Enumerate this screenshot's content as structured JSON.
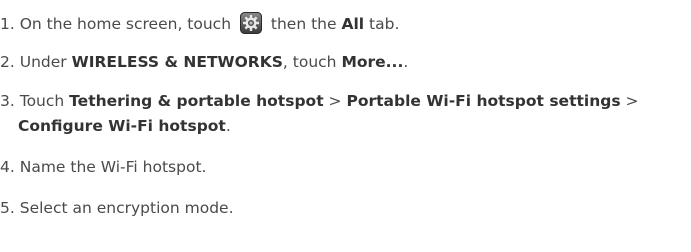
{
  "steps": {
    "s1": {
      "num": "1.",
      "text_a": "On the home screen, touch",
      "icon": "settings-gear-icon",
      "text_b": "then the",
      "bold_a": "All",
      "text_c": "tab."
    },
    "s2": {
      "num": "2.",
      "text_a": "Under",
      "bold_a": "WIRELESS & NETWORKS",
      "text_b": ", touch",
      "bold_b": "More...",
      "text_c": "."
    },
    "s3": {
      "num": "3.",
      "text_a": "Touch",
      "bold_a": "Tethering & portable hotspot",
      "sep_a": ">",
      "bold_b": "Portable Wi-Fi hotspot settings",
      "sep_b": ">",
      "bold_c": "Configure Wi-Fi hotspot",
      "text_end": "."
    },
    "s4": {
      "num": "4.",
      "text": "Name the Wi-Fi hotspot."
    },
    "s5": {
      "num": "5.",
      "text": "Select an encryption mode."
    }
  }
}
